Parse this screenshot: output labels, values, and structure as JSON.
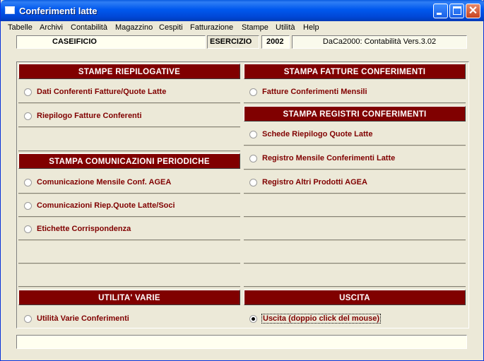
{
  "window": {
    "title": "Conferimenti latte"
  },
  "menu": [
    "Tabelle",
    "Archivi",
    "Contabilità",
    "Magazzino",
    "Cespiti",
    "Fatturazione",
    "Stampe",
    "Utilità",
    "Help"
  ],
  "info": {
    "company": "CASEIFICIO",
    "esercizio_label": "ESERCIZIO",
    "year": "2002",
    "version": "DaCa2000: Contabilità Vers.3.02"
  },
  "left": {
    "riepilogative": {
      "title": "STAMPE RIEPILOGATIVE",
      "items": [
        "Dati Conferenti Fatture/Quote Latte",
        "Riepilogo Fatture Conferenti"
      ]
    },
    "comunicazioni": {
      "title": "STAMPA COMUNICAZIONI PERIODICHE",
      "items": [
        "Comunicazione Mensile Conf. AGEA",
        "Comunicazioni Riep.Quote Latte/Soci",
        "Etichette Corrispondenza"
      ]
    },
    "utilita": {
      "title": "UTILITA'  VARIE",
      "items": [
        "Utilità Varie Conferimenti"
      ]
    }
  },
  "right": {
    "fatture": {
      "title": "STAMPA FATTURE CONFERIMENTI",
      "items": [
        "Fatture Conferimenti Mensili"
      ]
    },
    "registri": {
      "title": "STAMPA REGISTRI CONFERIMENTI",
      "items": [
        "Schede Riepilogo Quote Latte",
        "Registro Mensile Conferimenti Latte",
        "Registro Altri Prodotti AGEA"
      ]
    },
    "uscita": {
      "title": "USCITA",
      "items": [
        "Uscita (doppio click del mouse)"
      ]
    }
  },
  "status": {
    "text": ""
  }
}
